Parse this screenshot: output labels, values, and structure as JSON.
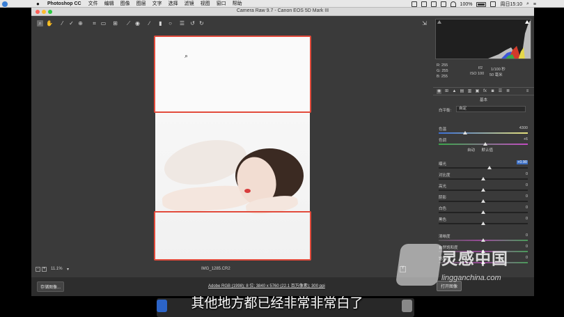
{
  "menubar": {
    "app_name": "Photoshop CC",
    "items": [
      "文件",
      "编辑",
      "图像",
      "图层",
      "文字",
      "选择",
      "滤镜",
      "视图",
      "窗口",
      "帮助"
    ],
    "battery": "100%",
    "clock": "周日15:10"
  },
  "window": {
    "title": "Camera Raw 9.7  -  Canon EOS 5D Mark III"
  },
  "toolbar": {
    "tools": [
      "zoom-icon",
      "hand-icon",
      "white-balance-icon",
      "color-sampler-icon",
      "targeted-adjustment-icon",
      "crop-icon",
      "straighten-icon",
      "transform-icon",
      "spot-removal-icon",
      "red-eye-icon",
      "adjustment-brush-icon",
      "graduated-filter-icon",
      "radial-filter-icon",
      "preferences-icon",
      "rotate-left-icon",
      "rotate-right-icon"
    ],
    "fullscreen_icon": "fullscreen-icon"
  },
  "canvas": {
    "zoom_value": "11.1%",
    "zoom_dropdown": "▾",
    "filename": "IMG_1285.CR2"
  },
  "footer": {
    "save_label": "存储图像...",
    "workflow_link": "Adobe RGB (1998); 8 位; 3840 x 5760 (22.1 百万像素); 300 ppi",
    "open_label": "打开图像"
  },
  "readout": {
    "r": "R:  255",
    "g": "G:  255",
    "b": "B:  255",
    "aperture": "f/2",
    "shutter": "1/100 秒",
    "iso": "ISO 100",
    "focal": "50 毫米"
  },
  "panel": {
    "section_title": "基本",
    "wb_label": "白平衡:",
    "wb_value": "自定",
    "auto_label": "自动",
    "default_label": "默认值",
    "sliders": [
      {
        "label": "色温",
        "value": "4300",
        "pos": 0.3,
        "hl": false
      },
      {
        "label": "色调",
        "value": "+6",
        "pos": 0.52,
        "hl": false
      },
      {
        "label": "曝光",
        "value": "+0.90",
        "pos": 0.57,
        "hl": true
      },
      {
        "label": "对比度",
        "value": "0",
        "pos": 0.5,
        "hl": false
      },
      {
        "label": "高光",
        "value": "0",
        "pos": 0.5,
        "hl": false
      },
      {
        "label": "阴影",
        "value": "0",
        "pos": 0.5,
        "hl": false
      },
      {
        "label": "白色",
        "value": "0",
        "pos": 0.5,
        "hl": false
      },
      {
        "label": "黑色",
        "value": "0",
        "pos": 0.5,
        "hl": false
      },
      {
        "label": "清晰度",
        "value": "0",
        "pos": 0.5,
        "hl": false
      },
      {
        "label": "自然饱和度",
        "value": "0",
        "pos": 0.5,
        "hl": false
      },
      {
        "label": "饱和度",
        "value": "0",
        "pos": 0.5,
        "hl": false
      }
    ]
  },
  "watermark": {
    "brand": "灵感中国",
    "url": "lingganchina.com"
  },
  "subtitle": "其他地方都已经非常非常白了"
}
